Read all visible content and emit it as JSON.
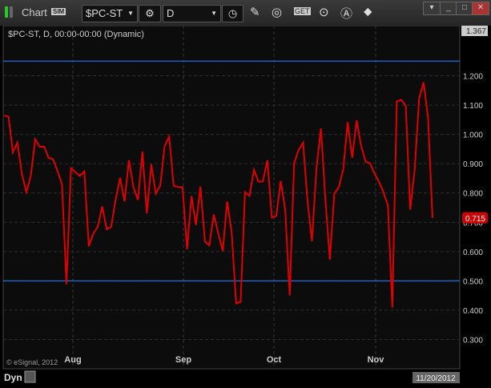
{
  "window": {
    "title": "Chart",
    "sim_badge": "SIM",
    "symbol": "$PC-ST",
    "interval": "D",
    "dyn_label": "Dyn"
  },
  "chart_data": {
    "type": "line",
    "title": "$PC-ST, D, 00:00-00:00 (Dynamic)",
    "copyright": "© eSignal, 2012",
    "x_tick_labels": [
      "Aug",
      "Sep",
      "Oct",
      "Nov"
    ],
    "x_end_label": "11/20/2012",
    "y_tick_labels": [
      "1.200",
      "1.100",
      "1.000",
      "0.900",
      "0.800",
      "0.700",
      "0.600",
      "0.500",
      "0.400",
      "0.300"
    ],
    "y_top_label": "1.367",
    "last_value_label": "0.715",
    "ylim": [
      0.2,
      1.367
    ],
    "reference_lines": [
      1.25,
      0.5
    ],
    "colors": {
      "series": "#e00000",
      "reference": "#1e6fe0",
      "bg": "#0c0c0c"
    },
    "series": [
      {
        "name": "$PC-ST",
        "values": [
          1.064,
          1.061,
          0.939,
          0.972,
          0.866,
          0.803,
          0.858,
          0.983,
          0.958,
          0.958,
          0.92,
          0.915,
          0.874,
          0.83,
          0.488,
          0.885,
          0.871,
          0.858,
          0.874,
          0.618,
          0.662,
          0.684,
          0.754,
          0.676,
          0.684,
          0.776,
          0.852,
          0.771,
          0.912,
          0.82,
          0.776,
          0.942,
          0.73,
          0.898,
          0.798,
          0.825,
          0.961,
          0.993,
          0.825,
          0.82,
          0.82,
          0.608,
          0.79,
          0.69,
          0.822,
          0.635,
          0.621,
          0.727,
          0.662,
          0.602,
          0.771,
          0.667,
          0.423,
          0.428,
          0.803,
          0.79,
          0.879,
          0.839,
          0.839,
          0.912,
          0.716,
          0.722,
          0.841,
          0.743,
          0.45,
          0.901,
          0.947,
          0.972,
          0.771,
          0.635,
          0.885,
          1.021,
          0.776,
          0.572,
          0.798,
          0.82,
          0.879,
          1.042,
          0.92,
          1.048,
          0.961,
          0.907,
          0.901,
          0.866,
          0.839,
          0.803,
          0.757,
          0.409,
          1.113,
          1.118,
          1.097,
          0.743,
          0.879,
          1.124,
          1.178,
          1.056,
          0.715
        ]
      }
    ]
  }
}
